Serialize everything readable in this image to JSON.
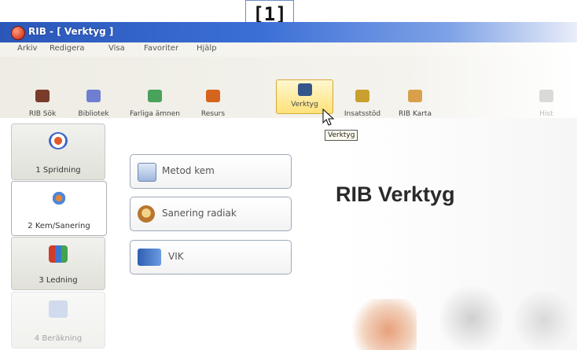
{
  "window": {
    "title": "RIB - [ Verktyg ]"
  },
  "callout": {
    "label": "[1]"
  },
  "menu": {
    "items": [
      "Arkiv",
      "Redigera",
      "Visa",
      "Favoriter",
      "Hjälp"
    ]
  },
  "toolbar": {
    "buttons": [
      {
        "label": "RIB Sök",
        "icon": "search-binoculars-icon"
      },
      {
        "label": "Bibliotek",
        "icon": "book-library-icon"
      },
      {
        "label": "Farliga ämnen",
        "icon": "flask-icon"
      },
      {
        "label": "Resurs",
        "icon": "resource-icon"
      },
      {
        "label": "Verktyg",
        "icon": "tools-icon"
      },
      {
        "label": "Insatsstöd",
        "icon": "checklist-icon"
      },
      {
        "label": "RIB Karta",
        "icon": "map-icon"
      }
    ],
    "active_label": "Verktyg",
    "tooltip": "Verktyg",
    "faded_right_label": "Hist"
  },
  "sidebar": {
    "tabs": [
      {
        "label": "1 Spridning",
        "icon": "spread-target-icon"
      },
      {
        "label": "2 Kem/Sanering",
        "icon": "molecule-icon"
      },
      {
        "label": "3 Ledning",
        "icon": "people-command-icon"
      },
      {
        "label": "4 Beräkning",
        "icon": "calculator-icon"
      }
    ],
    "selected_index": 1
  },
  "actions": {
    "buttons": [
      {
        "label": "Metod kem",
        "icon": "document-method-icon"
      },
      {
        "label": "Sanering radiak",
        "icon": "radiation-cleanup-icon"
      },
      {
        "label": "VIK",
        "icon": "vik-icon"
      }
    ]
  },
  "main": {
    "heading": "RIB Verktyg"
  },
  "colors": {
    "titlebar": "#2b57b8",
    "active_tool_bg": "#ffe27a",
    "callout_border": "#6e8bc8"
  }
}
